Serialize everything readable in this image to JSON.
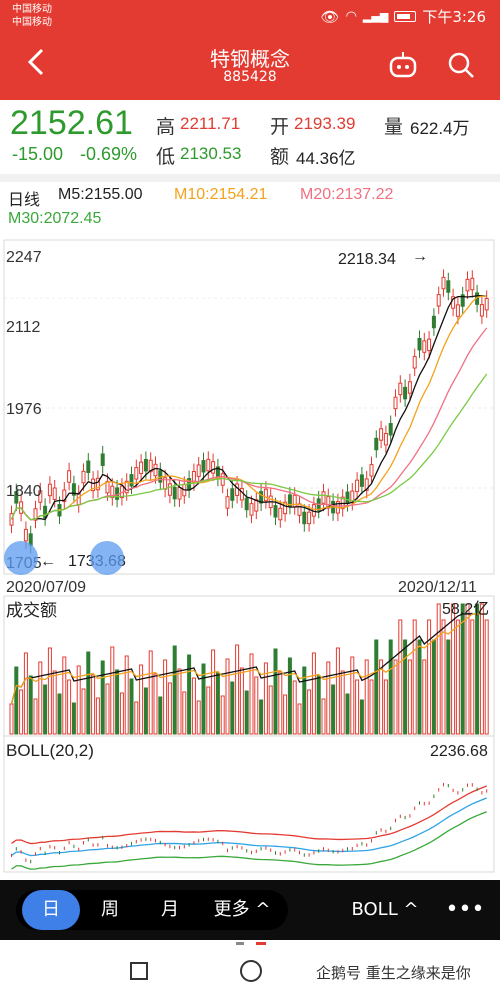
{
  "status": {
    "carrier1": "中国移动",
    "carrier2": "中国移动",
    "icons": [
      "eye-icon",
      "wifi-icon",
      "signal-4g-icon",
      "battery-icon"
    ],
    "time": "下午3:26"
  },
  "header": {
    "title": "特钢概念",
    "code": "885428",
    "icons": [
      "back-icon",
      "robot-icon",
      "search-icon"
    ]
  },
  "quote": {
    "price": "2152.61",
    "change": "-15.00",
    "change_pct": "-0.69%",
    "high_label": "高",
    "high": "2211.71",
    "open_label": "开",
    "open": "2193.39",
    "volume_label": "量",
    "volume": "622.4万",
    "low_label": "低",
    "low": "2130.53",
    "amount_label": "额",
    "amount": "44.36亿"
  },
  "ma": {
    "period": "日线",
    "m5": "M5:2155.00",
    "m10": "M10:2154.21",
    "m20": "M20:2137.22",
    "m30": "M30:2072.45"
  },
  "chart": {
    "y_ticks": [
      "2247",
      "2112",
      "1976",
      "1840",
      "1705"
    ],
    "max_label": "2218.34",
    "min_label": "1733.68",
    "date_start": "2020/07/09",
    "date_end": "2020/12/11",
    "volume_title": "成交额",
    "volume_max": "58.2亿",
    "boll_title": "BOLL(20,2)",
    "boll_value": "2236.68",
    "colors": {
      "up": "#e33b32",
      "down": "#2e7d32",
      "m5": "#111111",
      "m10": "#f2a21c",
      "m20": "#f07080",
      "m30": "#7ac943",
      "boll_mid": "#2ea4e6",
      "boll_up": "#e33b32",
      "boll_low": "#3aa83a"
    }
  },
  "timeframes": {
    "day": "日",
    "week": "周",
    "month": "月",
    "more": "更多 ^",
    "indicator": "BOLL ^",
    "menu_icon": "more-dots-icon"
  },
  "watermark": "企鹅号 重生之缘来是你"
}
